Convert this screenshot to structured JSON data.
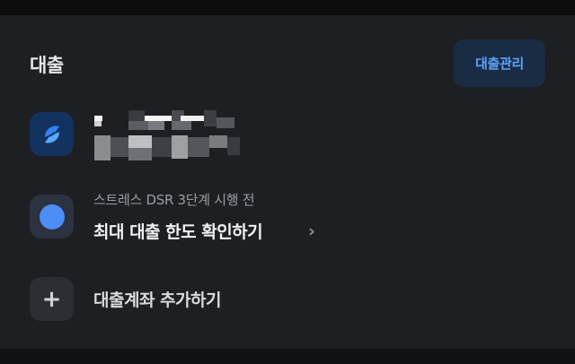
{
  "section": {
    "title": "대출",
    "manage_button": "대출관리"
  },
  "loan_item": {
    "icon": "bank-logo-icon",
    "name_redacted": true
  },
  "dsr_item": {
    "icon": "dot-icon",
    "sub_label": "스트레스 DSR 3단계 시행 전",
    "main_label": "최대 대출 한도 확인하기",
    "chevron": "›"
  },
  "add_item": {
    "icon": "plus-icon",
    "icon_glyph": "+",
    "label": "대출계좌 추가하기"
  },
  "colors": {
    "background": "#1e1f23",
    "accent": "#5ea4ff",
    "accent_bg": "#1a2b44",
    "dsr_dot": "#4f8df6"
  }
}
